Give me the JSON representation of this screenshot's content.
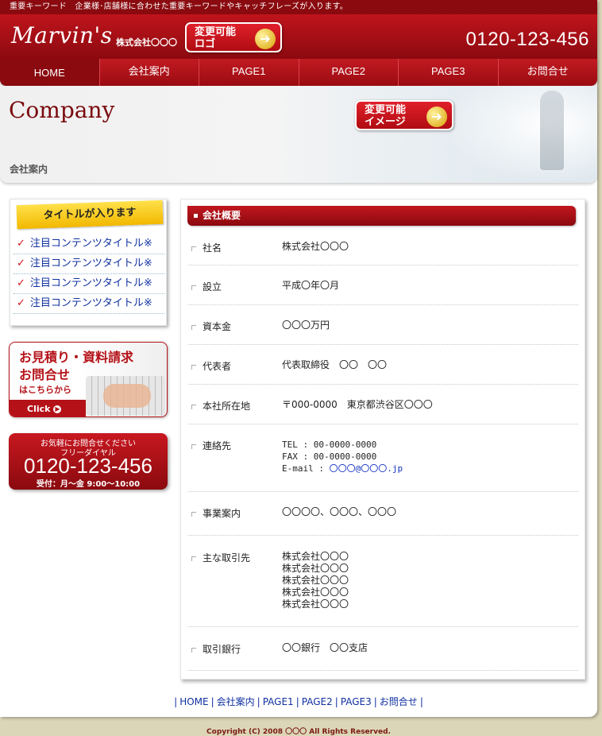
{
  "topbar": {
    "keywords": "重要キーワード　企業様･店舗様に合わせた重要キーワードやキャッチフレーズが入ります。"
  },
  "header": {
    "logo": "Marvin's",
    "company": "株式会社〇〇〇",
    "logo_badge_line1": "変更可能",
    "logo_badge_line2": "ロゴ",
    "phone": "0120-123-456"
  },
  "nav": {
    "items": [
      {
        "label": "HOME"
      },
      {
        "label": "会社案内"
      },
      {
        "label": "PAGE1"
      },
      {
        "label": "PAGE2"
      },
      {
        "label": "PAGE3"
      },
      {
        "label": "お問合せ"
      }
    ]
  },
  "hero": {
    "title": "Company",
    "subtitle": "会社案内",
    "image_badge_line1": "変更可能",
    "image_badge_line2": "イメージ"
  },
  "sidebar": {
    "box_title": "タイトルが入ります",
    "items": [
      {
        "label": "注目コンテンツタイトル※"
      },
      {
        "label": "注目コンテンツタイトル※"
      },
      {
        "label": "注目コンテンツタイトル※"
      },
      {
        "label": "注目コンテンツタイトル※"
      }
    ],
    "banner": {
      "line1": "お見積り・資料請求",
      "line2": "お問合せ",
      "line3": "はこちらから",
      "click": "Click"
    },
    "tel": {
      "line1": "お気軽にお問合せください",
      "line2": "フリーダイヤル",
      "number": "0120-123-456",
      "hours": "受付：月～金 9:00～10:00"
    }
  },
  "main": {
    "section_title": "会社概要",
    "rows": [
      {
        "label": "社名",
        "value": "株式会社〇〇〇"
      },
      {
        "label": "設立",
        "value": "平成〇年〇月"
      },
      {
        "label": "資本金",
        "value": "〇〇〇万円"
      },
      {
        "label": "代表者",
        "value": "代表取締役　〇〇　〇〇"
      },
      {
        "label": "本社所在地",
        "value": "〒000-0000　東京都渋谷区〇〇〇"
      },
      {
        "label": "連絡先",
        "tel": "TEL : 00-0000-0000",
        "fax": "FAX : 00-0000-0000",
        "email_prefix": "E-mail : ",
        "email": "〇〇〇@〇〇〇.jp"
      },
      {
        "label": "事業案内",
        "value": "〇〇〇〇、〇〇〇、〇〇〇"
      },
      {
        "label": "主な取引先",
        "values": [
          "株式会社〇〇〇",
          "株式会社〇〇〇",
          "株式会社〇〇〇",
          "株式会社〇〇〇",
          "株式会社〇〇〇"
        ]
      },
      {
        "label": "取引銀行",
        "value": "〇〇銀行　〇〇支店"
      }
    ]
  },
  "footer": {
    "links": [
      {
        "label": "HOME"
      },
      {
        "label": "会社案内"
      },
      {
        "label": "PAGE1"
      },
      {
        "label": "PAGE2"
      },
      {
        "label": "PAGE3"
      },
      {
        "label": "お問合せ"
      }
    ],
    "copyright": "Copyright (C) 2008 〇〇〇 All Rights Reserved."
  },
  "colors": {
    "brand": "#b41218",
    "dark": "#8a0a0f",
    "accent": "#f2b800",
    "link": "#1030a0"
  }
}
